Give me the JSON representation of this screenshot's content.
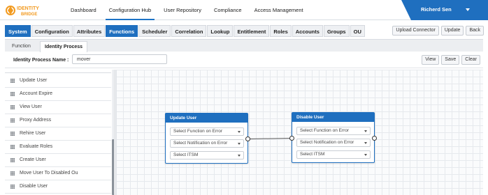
{
  "app": {
    "logo_line1": "IDENTITY",
    "logo_line2": "BRIDGE",
    "brand_color": "#1f6fbf"
  },
  "nav": {
    "items": [
      "Dashboard",
      "Configuration Hub",
      "User Repository",
      "Compliance",
      "Access Management"
    ],
    "active": "Configuration Hub",
    "user": "Richerd Sen"
  },
  "tabs": {
    "items": [
      "System",
      "Configuration",
      "Attributes",
      "Functions",
      "Scheduler",
      "Correlation",
      "Lookup",
      "Entitlement",
      "Roles",
      "Accounts",
      "Groups",
      "OU"
    ],
    "active": "Functions"
  },
  "toolbar": {
    "upload_connector": "Upload Connector",
    "update": "Update",
    "back": "Back"
  },
  "subtabs": {
    "items": [
      "Function",
      "Identity Process"
    ],
    "active": "Identity Process"
  },
  "process": {
    "name_label": "Identity Process Name :",
    "name_value": "mover",
    "view": "View",
    "save": "Save",
    "clear": "Clear"
  },
  "functions_list": [
    "Update User",
    "Account Expire",
    "View User",
    "Proxy Address",
    "Rehire User",
    "Evaluate Roles",
    "Create User",
    "Move User To Disabled Ou",
    "Disable User"
  ],
  "canvas": {
    "cards": [
      {
        "title": "Update User",
        "function_on_error": "Select Function on Error",
        "notification_on_error": "Select Notification on Error",
        "itsm": "Select ITSM"
      },
      {
        "title": "Disable User",
        "function_on_error": "Select Function on Error",
        "notification_on_error": "Select Notification on Error",
        "itsm": "Select ITSM"
      }
    ]
  }
}
